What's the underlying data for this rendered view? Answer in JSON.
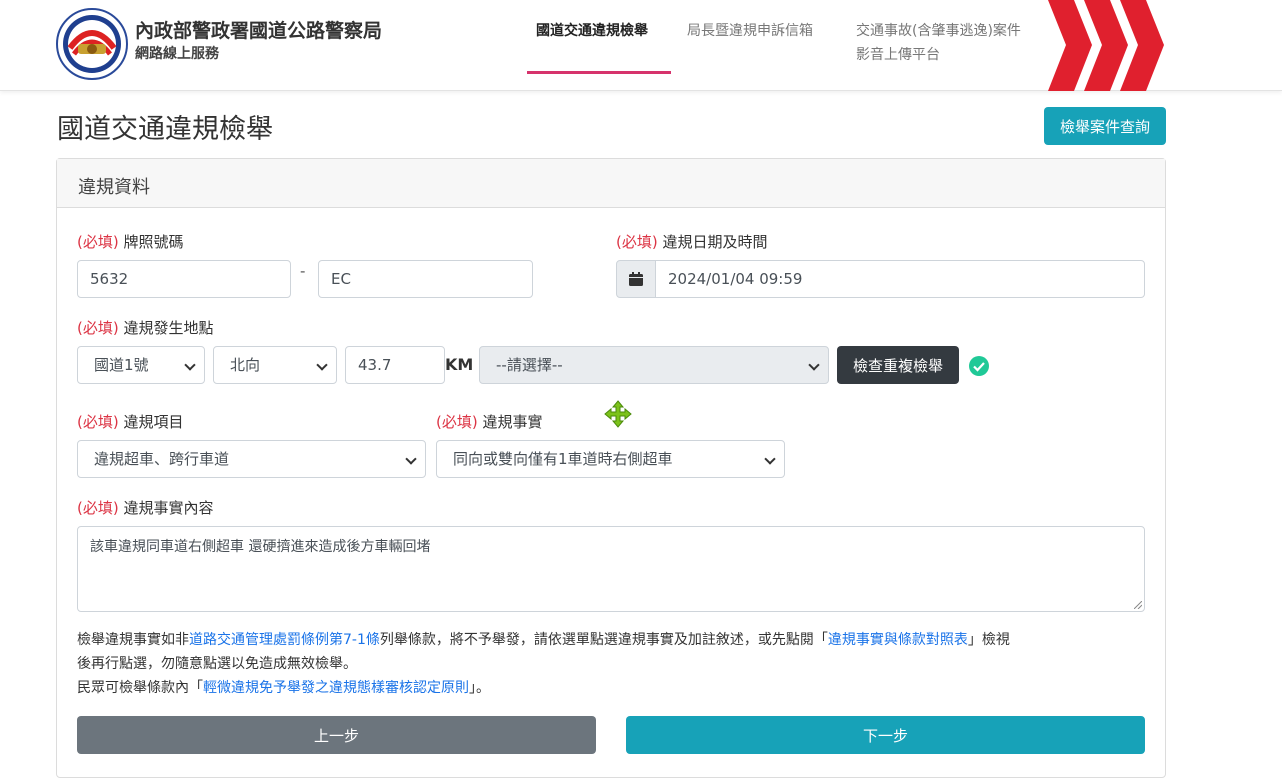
{
  "header": {
    "org_name": "內政部警政署國道公路警察局",
    "org_sub": "網路線上服務",
    "nav": [
      {
        "label": "國道交通違規檢舉"
      },
      {
        "label": "局長暨違規申訴信箱"
      },
      {
        "label_line1": "交通事故(含肇事逃逸)案件",
        "label_line2": "影音上傳平台"
      }
    ]
  },
  "page": {
    "title": "國道交通違規檢舉",
    "query_button": "檢舉案件查詢"
  },
  "card": {
    "title": "違規資料",
    "required_tag": "(必填)",
    "plate": {
      "label": "牌照號碼",
      "part1": "5632",
      "separator": "-",
      "part2": "EC"
    },
    "datetime": {
      "label": "違規日期及時間",
      "value": "2024/01/04 09:59"
    },
    "location": {
      "label": "違規發生地點",
      "highway": "國道1號",
      "direction": "北向",
      "km_value": "43.7",
      "km_unit": "KM",
      "interchange": "--請選擇--",
      "check_button": "檢查重複檢舉"
    },
    "item": {
      "label": "違規項目",
      "value": "違規超車、跨行車道"
    },
    "fact": {
      "label": "違規事實",
      "value": "同向或雙向僅有1車道時右側超車"
    },
    "content": {
      "label": "違規事實內容",
      "value": "該車違規同車道右側超車 還硬擠進來造成後方車輛回堵"
    },
    "notes": {
      "line1_a": "檢舉違規事實如非",
      "line1_link1": "道路交通管理處罰條例第7-1條",
      "line1_b": "列舉條款，將不予舉發，請依選單點選違規事實及加註敘述，或先點閱「",
      "line1_link2": "違規事實與條款對照表",
      "line1_c": "」檢視",
      "line2": "後再行點選，勿隨意點選以免造成無效檢舉。",
      "line3_a": "民眾可檢舉條款內「",
      "line3_link": "輕微違規免予舉發之違規態樣審核認定原則",
      "line3_b": "」。"
    },
    "prev_button": "上一步",
    "next_button": "下一步"
  },
  "colors": {
    "accent": "#17a2b8",
    "required": "#dc3545",
    "nav_underline": "#d6336c",
    "chevron": "#e0202e"
  }
}
